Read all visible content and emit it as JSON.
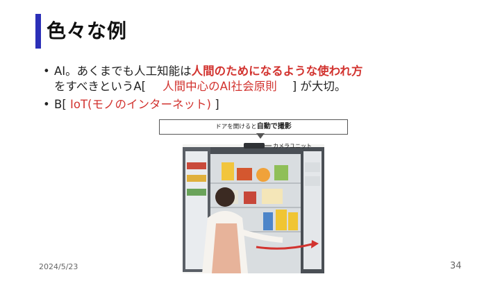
{
  "slide": {
    "title": "色々な例",
    "bullets": [
      {
        "prefix": "AI。あくまでも人工知能は",
        "emphasis": "人間のためになるような使われ方",
        "line2_start": "をすべきというA[",
        "answer": "人間中心のAI社会原則",
        "line2_end": "] が大切。"
      },
      {
        "prefix": "B[",
        "answer": "IoT(モノのインターネット)",
        "suffix": "]"
      }
    ],
    "image": {
      "caption_regular": "ドアを開けると",
      "caption_bold": "自動で撮影",
      "camera_label": "カメラユニット"
    },
    "footer_date": "2024/5/23",
    "page_number": "34"
  },
  "colors": {
    "title_bar": "#2b2fb8",
    "emphasis": "#d2332f",
    "fridge_body": "#4a4f55",
    "apron": "#e7b39a"
  }
}
